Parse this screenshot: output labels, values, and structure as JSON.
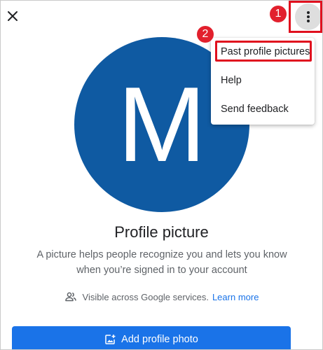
{
  "header": {
    "close_icon": "close-icon",
    "more_icon": "more-vert-icon"
  },
  "annotations": {
    "step_1": "1",
    "step_2": "2",
    "highlight_color": "#e0101e"
  },
  "avatar": {
    "letter": "M",
    "background_color": "#0f5aa2"
  },
  "menu": {
    "items": [
      {
        "label": "Past profile pictures"
      },
      {
        "label": "Help"
      },
      {
        "label": "Send feedback"
      }
    ]
  },
  "main": {
    "title": "Profile picture",
    "description": "A picture helps people recognize you and lets you know when you’re signed in to your account",
    "visibility_icon": "people-icon",
    "visibility_text": "Visible across Google services.",
    "learn_more_label": "Learn more",
    "accent_color": "#1a73e8"
  },
  "add_button": {
    "icon": "add-photo-icon",
    "label": "Add profile photo"
  }
}
